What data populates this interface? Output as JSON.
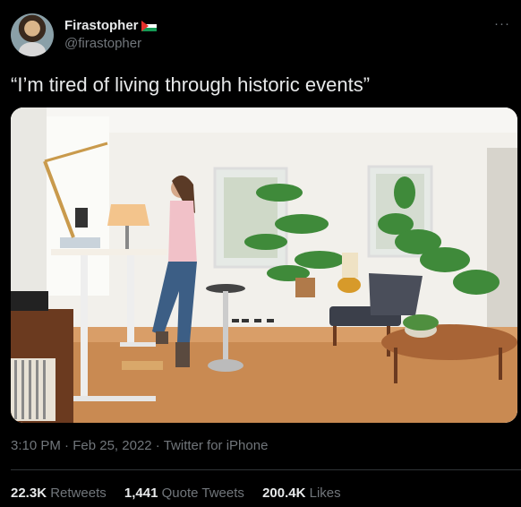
{
  "author": {
    "display_name": "Firastopher",
    "handle": "@firastopher",
    "flag_icon": "palestine-flag-icon",
    "avatar_icon": "avatar"
  },
  "menu": {
    "more_label": "···"
  },
  "tweet": {
    "text": "“I’m tired of living through historic events”",
    "time": "3:10 PM",
    "date": "Feb 25, 2022",
    "source": "Twitter for iPhone"
  },
  "stats": {
    "retweets_count": "22.3K",
    "retweets_label": "Retweets",
    "quotes_count": "1,441",
    "quotes_label": "Quote Tweets",
    "likes_count": "200.4K",
    "likes_label": "Likes"
  },
  "colors": {
    "background": "#000000",
    "text_primary": "#e7e9ea",
    "text_secondary": "#71767b"
  }
}
